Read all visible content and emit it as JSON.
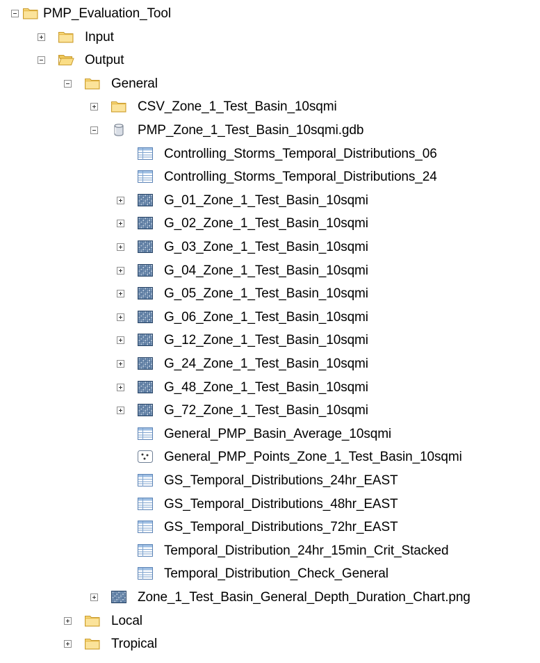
{
  "tree": {
    "root": {
      "label": "PMP_Evaluation_Tool",
      "icon": "folder-icon",
      "state": "expanded"
    },
    "input": {
      "label": "Input",
      "icon": "folder-icon",
      "state": "collapsed"
    },
    "output": {
      "label": "Output",
      "icon": "folder-open-icon",
      "state": "expanded"
    },
    "general": {
      "label": "General",
      "icon": "folder-icon",
      "state": "expanded"
    },
    "csv": {
      "label": "CSV_Zone_1_Test_Basin_10sqmi",
      "icon": "folder-icon",
      "state": "collapsed"
    },
    "gdb": {
      "label": "PMP_Zone_1_Test_Basin_10sqmi.gdb",
      "icon": "geodatabase-icon",
      "state": "expanded",
      "items": [
        {
          "label": "Controlling_Storms_Temporal_Distributions_06",
          "icon": "table-icon",
          "expandable": false
        },
        {
          "label": "Controlling_Storms_Temporal_Distributions_24",
          "icon": "table-icon",
          "expandable": false
        },
        {
          "label": "G_01_Zone_1_Test_Basin_10sqmi",
          "icon": "raster-icon",
          "expandable": true
        },
        {
          "label": "G_02_Zone_1_Test_Basin_10sqmi",
          "icon": "raster-icon",
          "expandable": true
        },
        {
          "label": "G_03_Zone_1_Test_Basin_10sqmi",
          "icon": "raster-icon",
          "expandable": true
        },
        {
          "label": "G_04_Zone_1_Test_Basin_10sqmi",
          "icon": "raster-icon",
          "expandable": true
        },
        {
          "label": "G_05_Zone_1_Test_Basin_10sqmi",
          "icon": "raster-icon",
          "expandable": true
        },
        {
          "label": "G_06_Zone_1_Test_Basin_10sqmi",
          "icon": "raster-icon",
          "expandable": true
        },
        {
          "label": "G_12_Zone_1_Test_Basin_10sqmi",
          "icon": "raster-icon",
          "expandable": true
        },
        {
          "label": "G_24_Zone_1_Test_Basin_10sqmi",
          "icon": "raster-icon",
          "expandable": true
        },
        {
          "label": "G_48_Zone_1_Test_Basin_10sqmi",
          "icon": "raster-icon",
          "expandable": true
        },
        {
          "label": "G_72_Zone_1_Test_Basin_10sqmi",
          "icon": "raster-icon",
          "expandable": true
        },
        {
          "label": "General_PMP_Basin_Average_10sqmi",
          "icon": "table-icon",
          "expandable": false
        },
        {
          "label": "General_PMP_Points_Zone_1_Test_Basin_10sqmi",
          "icon": "point-feature-class-icon",
          "expandable": false
        },
        {
          "label": "GS_Temporal_Distributions_24hr_EAST",
          "icon": "table-icon",
          "expandable": false
        },
        {
          "label": "GS_Temporal_Distributions_48hr_EAST",
          "icon": "table-icon",
          "expandable": false
        },
        {
          "label": "GS_Temporal_Distributions_72hr_EAST",
          "icon": "table-icon",
          "expandable": false
        },
        {
          "label": "Temporal_Distribution_24hr_15min_Crit_Stacked",
          "icon": "table-icon",
          "expandable": false
        },
        {
          "label": "Temporal_Distribution_Check_General",
          "icon": "table-icon",
          "expandable": false
        }
      ]
    },
    "png": {
      "label": "Zone_1_Test_Basin_General_Depth_Duration_Chart.png",
      "icon": "raster-icon",
      "state": "collapsed"
    },
    "local": {
      "label": "Local",
      "icon": "folder-icon",
      "state": "collapsed"
    },
    "tropical": {
      "label": "Tropical",
      "icon": "folder-icon",
      "state": "collapsed"
    }
  }
}
